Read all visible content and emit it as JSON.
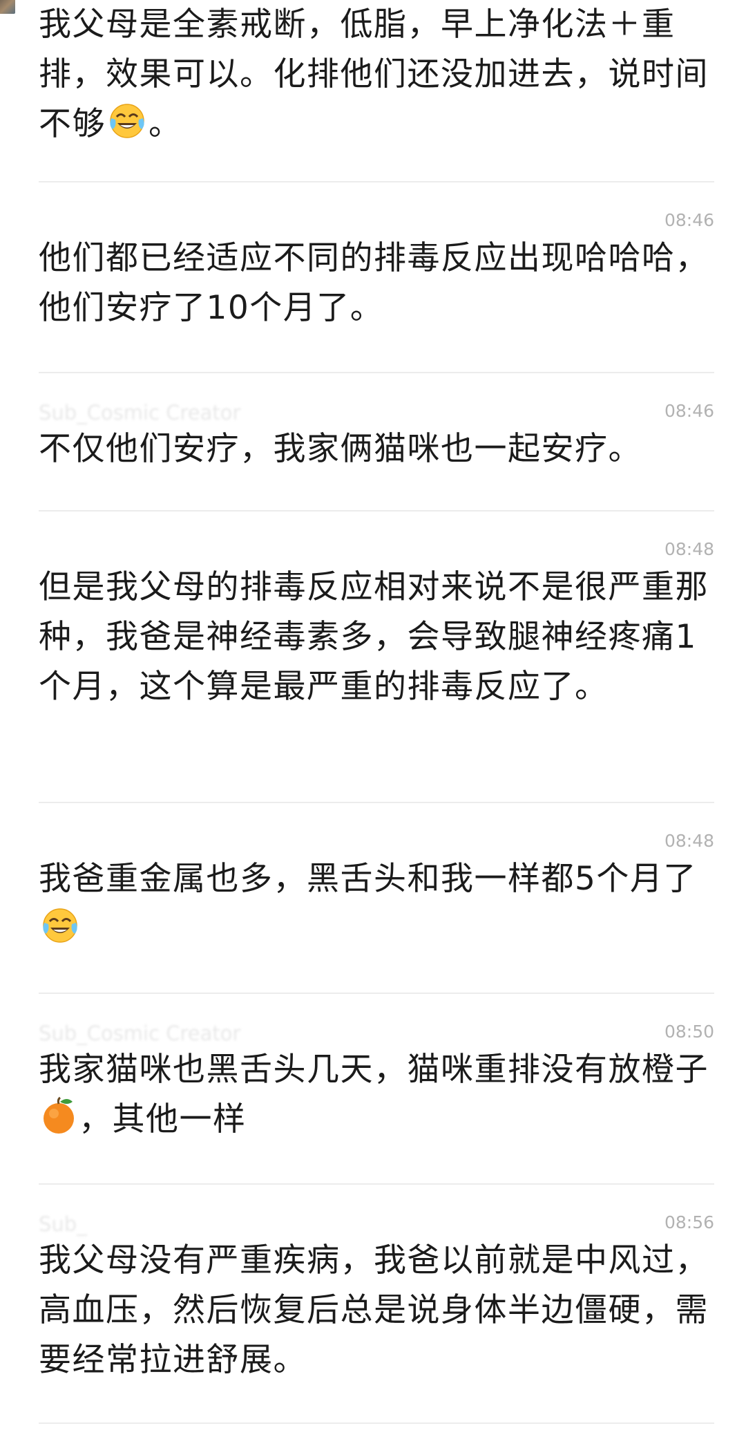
{
  "messages": [
    {
      "sender": "",
      "time": "",
      "segments": [
        {
          "text": "我父母是全素戒断，低脂，早上净化法＋重排，效果可以。化排他们还没加进去，说时间不够"
        },
        {
          "emoji": "tears-of-joy"
        },
        {
          "text": "。"
        }
      ]
    },
    {
      "sender": "",
      "time": "08:46",
      "segments": [
        {
          "text": "他们都已经适应不同的排毒反应出现哈哈哈，他们安疗了10个月了。"
        }
      ]
    },
    {
      "sender": "Sub_Cosmic Creator",
      "time": "08:46",
      "segments": [
        {
          "text": "不仅他们安疗，我家俩猫咪也一起安疗。"
        }
      ]
    },
    {
      "sender": "",
      "time": "08:48",
      "segments": [
        {
          "text": "但是我父母的排毒反应相对来说不是很严重那种，我爸是神经毒素多，会导致腿神经疼痛1个月，这个算是最严重的排毒反应了。"
        }
      ]
    },
    {
      "sender": "",
      "time": "08:48",
      "segments": [
        {
          "text": "我爸重金属也多，黑舌头和我一样都5个月了"
        },
        {
          "emoji": "tears-of-joy"
        }
      ]
    },
    {
      "sender": "Sub_Cosmic Creator",
      "time": "08:50",
      "segments": [
        {
          "text": "我家猫咪也黑舌头几天，猫咪重排没有放橙子"
        },
        {
          "emoji": "tangerine"
        },
        {
          "text": "，其他一样"
        }
      ]
    },
    {
      "sender": "Sub_",
      "time": "08:56",
      "segments": [
        {
          "text": "我父母没有严重疾病，我爸以前就是中风过，高血压，然后恢复后总是说身体半边僵硬，需要经常拉进舒展。"
        }
      ]
    }
  ],
  "colors": {
    "text": "#1b1b1b",
    "time": "#b2b2b2",
    "divider": "#ececec",
    "background": "#ffffff"
  }
}
